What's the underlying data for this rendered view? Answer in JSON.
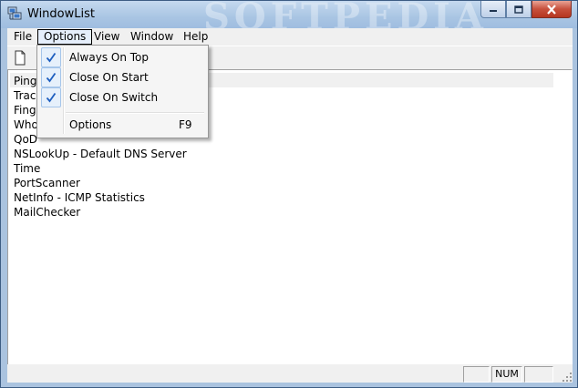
{
  "window": {
    "title": "WindowList",
    "watermark": "SOFTPEDIA"
  },
  "menubar": [
    "File",
    "Options",
    "View",
    "Window",
    "Help"
  ],
  "options_menu": {
    "items": [
      {
        "label": "Always On Top",
        "checked": true
      },
      {
        "label": "Close On Start",
        "checked": true
      },
      {
        "label": "Close On Switch",
        "checked": true
      }
    ],
    "options_label": "Options",
    "options_shortcut": "F9"
  },
  "list": [
    {
      "visible_text": "Ping"
    },
    {
      "visible_text": "Trace"
    },
    {
      "visible_text": "Finge"
    },
    {
      "visible_text": "WhoI"
    },
    {
      "visible_text": "QoD"
    },
    {
      "visible_text": "NSLookUp - Default DNS Server"
    },
    {
      "visible_text": "Time"
    },
    {
      "visible_text": "PortScanner"
    },
    {
      "visible_text": "NetInfo - ICMP Statistics"
    },
    {
      "visible_text": "MailChecker"
    }
  ],
  "statusbar": {
    "num_label": "NUM"
  },
  "colors": {
    "titlebar": "#a9c5e3",
    "close_button": "#c7503c",
    "checkmark": "#1f5fbf",
    "chrome": "#f0f0f0"
  },
  "icons": {
    "app": "network-computer-icon",
    "toolbar": "new-document-icon"
  }
}
